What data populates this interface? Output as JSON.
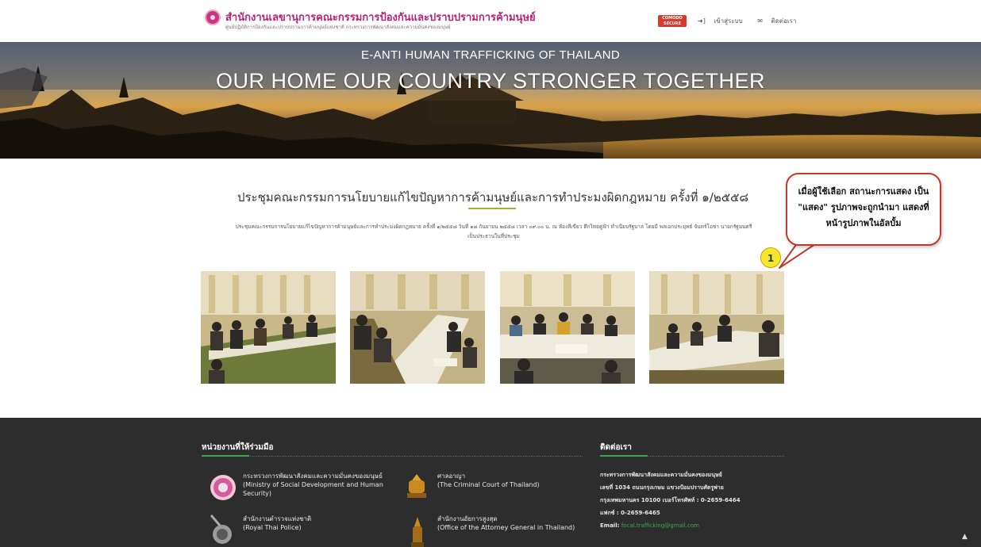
{
  "header": {
    "site_title": "สำนักงานเลขานุการคณะกรรมการป้องกันและปราบปรามการค้ามนุษย์",
    "site_subtitle": "ศูนย์ปฏิบัติการป้องกันและปราบปรามการค้ามนุษย์แห่งชาติ กระทรวงการพัฒนาสังคมและความมั่นคงของมนุษย์",
    "secure_badge_line1": "COMODO",
    "secure_badge_line2": "SECURE",
    "login_label": "เข้าสู่ระบบ",
    "contact_label": "ติดต่อเรา",
    "login_icon": "sign-in-icon",
    "contact_icon": "envelope-icon"
  },
  "banner": {
    "subtitle": "E-ANTI HUMAN TRAFFICKING OF THAILAND",
    "title": "OUR HOME OUR COUNTRY STRONGER TOGETHER"
  },
  "article": {
    "title": "ประชุมคณะกรรมการนโยบายแก้ไขปัญหาการค้ามนุษย์และการทำประมงผิดกฎหมาย ครั้งที่ ๑/๒๕๕๘",
    "description": "ประชุมคณะกรรมการนโยบายแก้ไขปัญหาการค้ามนุษย์และการทำประมงผิดกฎหมาย ครั้งที่ ๑/๒๕๕๘ วันที่ ๑๘ กันยายน ๒๕๕๘ เวลา ๐๙.๐๐ น. ณ ห้องสีเขียว ตึกไทยคู่ฟ้า ทำเนียบรัฐบาล โดยมี พลเอกประยุทธ์ จันทร์โอชา นายกรัฐมนตรี เป็นประธานในที่ประชุม",
    "photos": [
      "meeting-photo-1",
      "meeting-photo-2",
      "meeting-photo-3",
      "meeting-photo-4"
    ]
  },
  "annotation": {
    "callout_text": "เมื่อผู้ใช้เลือก สถานะการแสดง เป็น \"แสดง\" รูปภาพจะถูกนำมา แสดงที่หน้ารูปภาพในอัลบั้ม",
    "marker_number": "1",
    "callout_border_color": "#c0392b",
    "marker_color": "#f5e72e"
  },
  "footer": {
    "partners_heading": "หน่วยงานที่ให้ร่วมมือ",
    "contact_heading": "ติดต่อเรา",
    "accent_color": "#3da54a",
    "partners": [
      {
        "name": "กระทรวงการพัฒนาสังคมและความมั่นคงของมนุษย์",
        "english": "(Ministry of Social Development and Human Security)",
        "icon": "ministry-emblem-icon"
      },
      {
        "name": "ศาลอาญา",
        "english": "(The Criminal Court of Thailand)",
        "icon": "court-emblem-icon"
      },
      {
        "name": "สำนักงานตำรวจแห่งชาติ",
        "english": "(Royal Thai Police)",
        "icon": "police-emblem-icon"
      },
      {
        "name": "สำนักงานอัยการสูงสุด",
        "english": "(Office of the Attorney General in Thailand)",
        "icon": "attorney-emblem-icon"
      }
    ],
    "contact": {
      "org": "กระทรวงการพัฒนาสังคมและความมั่นคงของมนุษย์",
      "address1": "เลขที่ 1034 ถนนกรุงเกษม แขวงป้อมปราบศัตรูพ่าย",
      "address2": "กรุงเทพมหานคร 10100 เบอร์โทรศัพท์ : 0-2659-6464",
      "fax": "แฟกซ์ : 0-2659-6465",
      "email_label": "Email:",
      "email": "focal.trafficking@gmail.com"
    },
    "scroll_top_icon": "chevron-up-icon"
  }
}
